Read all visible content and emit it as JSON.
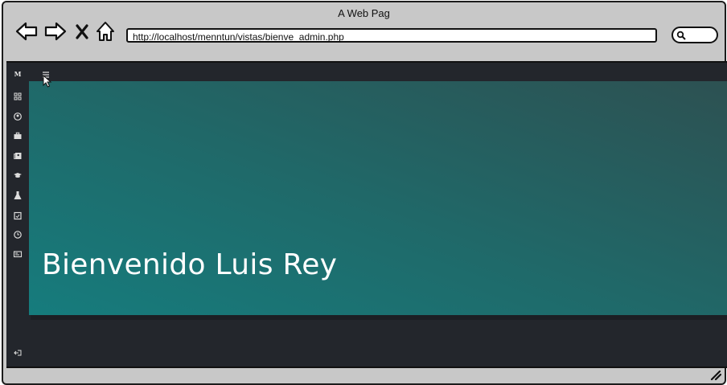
{
  "window": {
    "title": "A Web Pag"
  },
  "address_bar": {
    "url": "http://localhost/menntun/vistas/bienve_admin.php"
  },
  "sidebar": {
    "brand": "M",
    "items": [
      {
        "icon": "dashboard-icon"
      },
      {
        "icon": "user-circle-icon"
      },
      {
        "icon": "briefcase-icon"
      },
      {
        "icon": "address-book-icon"
      },
      {
        "icon": "graduation-cap-icon"
      },
      {
        "icon": "flask-icon"
      },
      {
        "icon": "calendar-check-icon"
      },
      {
        "icon": "clock-icon"
      },
      {
        "icon": "id-card-icon"
      }
    ],
    "logout_icon": "sign-out-icon"
  },
  "hero": {
    "heading": "Bienvenido Luis Rey"
  },
  "colors": {
    "hero_start": "#167c7d",
    "hero_end": "#2d5152",
    "background": "#23262c"
  }
}
